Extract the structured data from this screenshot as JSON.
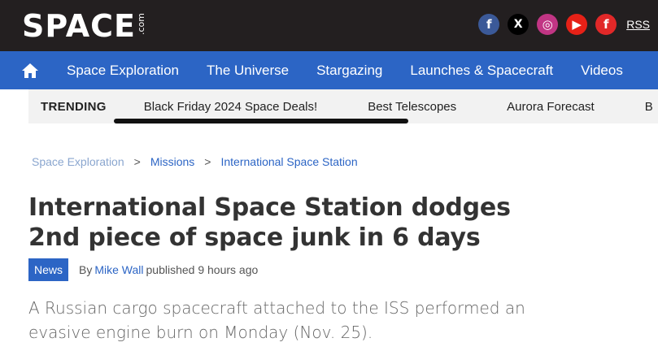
{
  "header": {
    "logo_main": "SPACE",
    "logo_com": ".com",
    "socials": {
      "facebook": "f",
      "x": "X",
      "instagram": "◎",
      "youtube": "▶",
      "flipboard": "f",
      "rss": "RSS"
    }
  },
  "nav": {
    "items": [
      "Space Exploration",
      "The Universe",
      "Stargazing",
      "Launches & Spacecraft",
      "Videos"
    ]
  },
  "trending": {
    "label": "TRENDING",
    "items": [
      "Black Friday 2024 Space Deals!",
      "Best Telescopes",
      "Aurora Forecast",
      "B"
    ]
  },
  "breadcrumb": [
    "Space Exploration",
    "Missions",
    "International Space Station"
  ],
  "breadcrumb_sep": ">",
  "article": {
    "title": "International Space Station dodges 2nd piece of space junk in 6 days",
    "badge": "News",
    "by": "By",
    "author": "Mike Wall",
    "published": "published 9 hours ago",
    "summary": "A Russian cargo spacecraft attached to the ISS performed an evasive engine burn on Monday (Nov. 25)."
  },
  "colors": {
    "brand_blue": "#2c65c5",
    "header_black": "#231f20"
  }
}
